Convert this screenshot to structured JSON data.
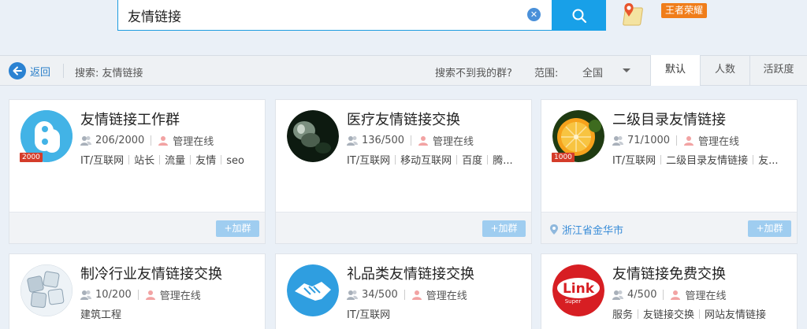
{
  "search": {
    "value": "友情链接",
    "clear_glyph": "✕"
  },
  "badge": {
    "label": "王者荣耀"
  },
  "filter": {
    "back_label": "返回",
    "search_label": "搜索: 友情链接",
    "cant_find": "搜索不到我的群?",
    "range_label": "范围:",
    "range_value": "全国",
    "sort_tabs": [
      "默认",
      "人数",
      "活跃度"
    ]
  },
  "cards": [
    {
      "title": "友情链接工作群",
      "members": "206/2000",
      "admin": "管理在线",
      "tags": [
        "IT/互联网",
        "站长",
        "流量",
        "友情",
        "seo"
      ],
      "level": "2000",
      "join": "+加群",
      "location": ""
    },
    {
      "title": "医疗友情链接交换",
      "members": "136/500",
      "admin": "管理在线",
      "tags": [
        "IT/互联网",
        "移动互联网",
        "百度",
        "腾..."
      ],
      "level": "",
      "join": "+加群",
      "location": ""
    },
    {
      "title": "二级目录友情链接",
      "members": "71/1000",
      "admin": "管理在线",
      "tags": [
        "IT/互联网",
        "二级目录友情链接",
        "友..."
      ],
      "level": "1000",
      "join": "+加群",
      "location": "浙江省金华市"
    },
    {
      "title": "制冷行业友情链接交换",
      "members": "10/200",
      "admin": "管理在线",
      "tags": [
        "建筑工程"
      ],
      "level": "",
      "join": "",
      "location": ""
    },
    {
      "title": "礼品类友情链接交换",
      "members": "34/500",
      "admin": "管理在线",
      "tags": [
        "IT/互联网"
      ],
      "level": "",
      "join": "",
      "location": ""
    },
    {
      "title": "友情链接免费交换",
      "members": "4/500",
      "admin": "管理在线",
      "tags": [
        "服务",
        "友链接交换",
        "网站友情链接"
      ],
      "level": "",
      "join": "",
      "location": "",
      "logo_text": "Link",
      "logo_sub": "Super"
    }
  ],
  "colors": {
    "accent": "#18a0e8",
    "join_button": "#9fcdf0",
    "badge": "#f07d1a"
  }
}
